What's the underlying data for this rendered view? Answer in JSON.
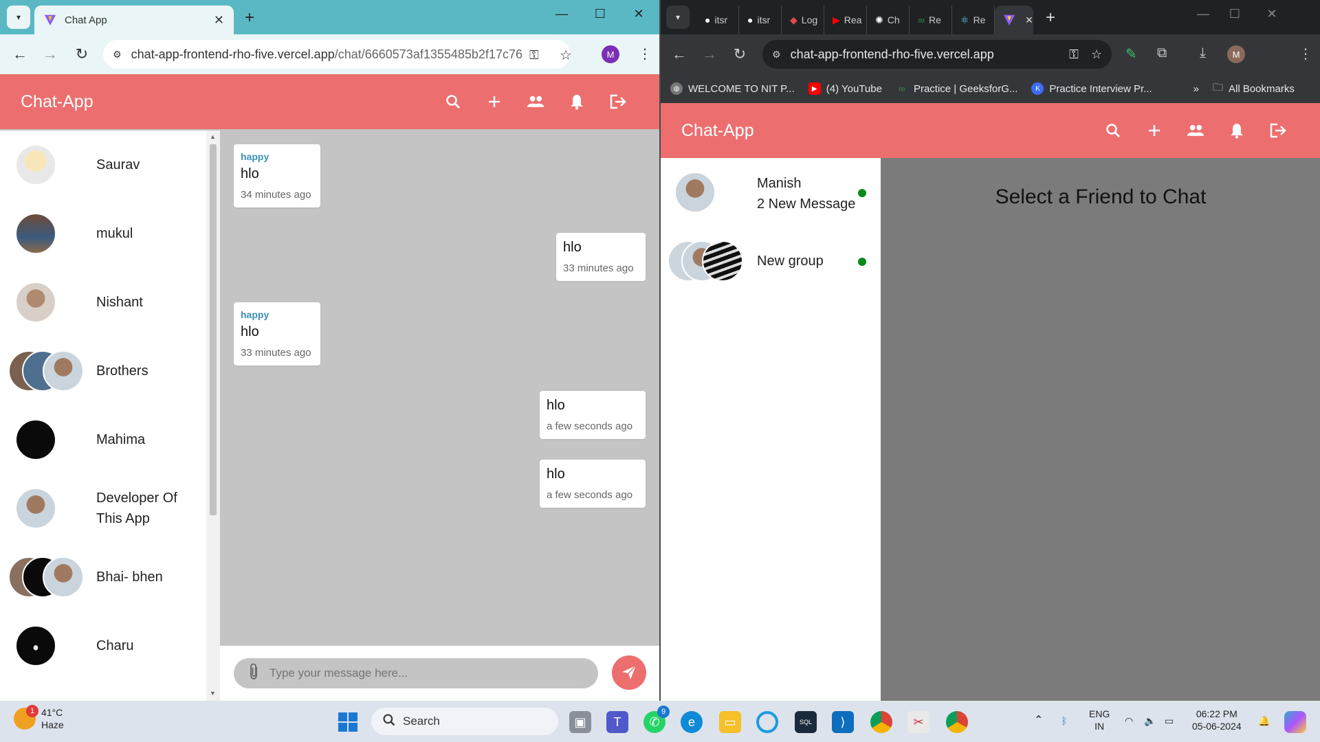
{
  "left_browser": {
    "tab_title": "Chat App",
    "url_main": "chat-app-frontend-rho-five.vercel.app",
    "url_rest": "/chat/6660573af1355485b2f17c76",
    "profile_initial": "M"
  },
  "right_browser": {
    "tabs": [
      "itsr",
      "itsr",
      "Log",
      "Rea",
      "Ch",
      "Re",
      "Re"
    ],
    "url_main": "chat-app-frontend-rho-five.vercel.app",
    "profile_initial": "M",
    "bookmarks": [
      "WELCOME TO NIT P...",
      "(4) YouTube",
      "Practice | GeeksforG...",
      "Practice Interview Pr..."
    ],
    "all_bookmarks": "All Bookmarks"
  },
  "app": {
    "title": "Chat-App",
    "accent": "#ec6e6e"
  },
  "contacts": [
    {
      "name": "Saurav"
    },
    {
      "name": "mukul"
    },
    {
      "name": "Nishant"
    },
    {
      "name": "Brothers"
    },
    {
      "name": "Mahima"
    },
    {
      "name": "Developer Of This App"
    },
    {
      "name": "Bhai- bhen"
    },
    {
      "name": "Charu"
    }
  ],
  "messages": [
    {
      "sender": "happy",
      "text": "hlo",
      "time": "34 minutes ago",
      "side": "left"
    },
    {
      "sender": "",
      "text": "hlo",
      "time": "33 minutes ago",
      "side": "right"
    },
    {
      "sender": "happy",
      "text": "hlo",
      "time": "33 minutes ago",
      "side": "left"
    },
    {
      "sender": "",
      "text": "hlo",
      "time": "a few seconds ago",
      "side": "right"
    },
    {
      "sender": "",
      "text": "hlo",
      "time": "a few seconds ago",
      "side": "right"
    }
  ],
  "composer": {
    "placeholder": "Type your message here..."
  },
  "right_contacts": [
    {
      "name": "Manish",
      "subtitle": "2 New Message"
    },
    {
      "name": "New group",
      "subtitle": ""
    }
  ],
  "right_placeholder": "Select a Friend to Chat",
  "taskbar": {
    "temperature": "41°C",
    "weather": "Haze",
    "weather_badge": "1",
    "search": "Search",
    "whatsapp_badge": "9",
    "lang_top": "ENG",
    "lang_bottom": "IN",
    "time": "06:22 PM",
    "date": "05-06-2024"
  }
}
